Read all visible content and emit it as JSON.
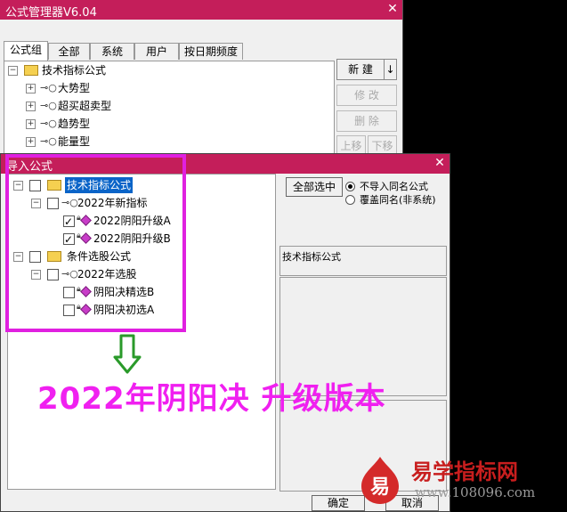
{
  "manager": {
    "title": "公式管理器V6.04",
    "close": "✕",
    "tabs": [
      "公式组",
      "全部",
      "系统",
      "用户",
      "按日期频度"
    ],
    "tree": {
      "root": "技术指标公式",
      "items": [
        "大势型",
        "超买超卖型",
        "趋势型",
        "能量型"
      ]
    },
    "buttons": {
      "new": "新  建",
      "new_arrow": "↓",
      "edit": "修  改",
      "delete": "删  除",
      "up": "上移",
      "down": "下移"
    }
  },
  "import_dialog": {
    "title": "导入公式",
    "close": "✕",
    "tree": {
      "group1": "技术指标公式",
      "group1_sub": "2022年新指标",
      "group1_items": [
        {
          "label": "2022阴阳升级A",
          "checked": true
        },
        {
          "label": "2022阴阳升级B",
          "checked": true
        }
      ],
      "group2": "条件选股公式",
      "group2_sub": "2022年选股",
      "group2_items": [
        {
          "label": "阴阳决精选B",
          "checked": false
        },
        {
          "label": "阴阳决初选A",
          "checked": false
        }
      ]
    },
    "select_all": "全部选中",
    "options": [
      {
        "label": "不导入同名公式",
        "selected": true
      },
      {
        "label": "覆盖同名(非系统)",
        "selected": false
      }
    ],
    "panel_text": "技术指标公式",
    "ok": "确定",
    "cancel": "取消"
  },
  "overlay": {
    "promo": "2022年阴阳决 升级版本",
    "watermark_title": "易学指标网",
    "watermark_url": "www.108096.com",
    "watermark_icon_char": "易",
    "highlight_color": "#e020e0",
    "arrow_color": "#2a9a2a"
  }
}
